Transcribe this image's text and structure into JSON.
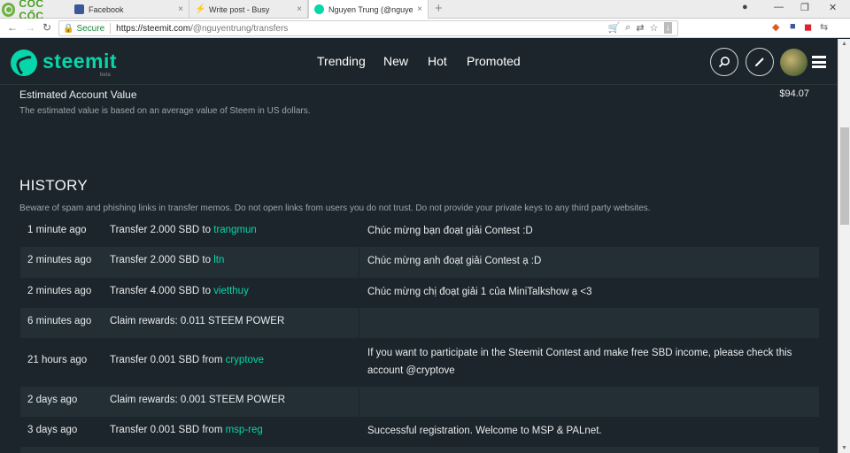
{
  "browser": {
    "brand": "CỐC CỐC",
    "tabs": [
      {
        "title": "Facebook",
        "close": "×"
      },
      {
        "title": "Write post - Busy",
        "close": "×"
      },
      {
        "title": "Nguyen Trung (@nguyent",
        "close": "×"
      }
    ],
    "new_tab": "+",
    "secure_label": "Secure",
    "url_host": "https://steemit.com",
    "url_path": "/@nguyentrung/transfers"
  },
  "header": {
    "logo_text": "steemit",
    "beta": "beta",
    "nav": [
      "Trending",
      "New",
      "Hot",
      "Promoted"
    ]
  },
  "account_value": {
    "title": "Estimated Account Value",
    "value": "$94.07",
    "description": "The estimated value is based on an average value of Steem in US dollars."
  },
  "history": {
    "title": "HISTORY",
    "warning": "Beware of spam and phishing links in transfer memos. Do not open links from users you do not trust. Do not provide your private keys to any third party websites.",
    "rows": [
      {
        "time": "1 minute ago",
        "desc_prefix": "Transfer 2.000 SBD to ",
        "user": "trangmun",
        "memo": "Chúc mừng bạn đoạt giải Contest :D"
      },
      {
        "time": "2 minutes ago",
        "desc_prefix": "Transfer 2.000 SBD to ",
        "user": "ltn",
        "memo": "Chúc mừng anh đoạt giải Contest ạ :D"
      },
      {
        "time": "2 minutes ago",
        "desc_prefix": "Transfer 4.000 SBD to ",
        "user": "vietthuy",
        "memo": "Chúc mừng chị đoạt giải 1 của MiniTalkshow ạ <3"
      },
      {
        "time": "6 minutes ago",
        "desc_prefix": "Claim rewards: 0.011 STEEM POWER",
        "user": "",
        "memo": ""
      },
      {
        "time": "21 hours ago",
        "desc_prefix": "Transfer 0.001 SBD from ",
        "user": "cryptove",
        "memo": "If you want to participate in the Steemit Contest and make free SBD income, please check this account @cryptove"
      },
      {
        "time": "2 days ago",
        "desc_prefix": "Claim rewards: 0.001 STEEM POWER",
        "user": "",
        "memo": ""
      },
      {
        "time": "3 days ago",
        "desc_prefix": "Transfer 0.001 SBD from ",
        "user": "msp-reg",
        "memo": "Successful registration. Welcome to MSP & PALnet."
      }
    ]
  }
}
